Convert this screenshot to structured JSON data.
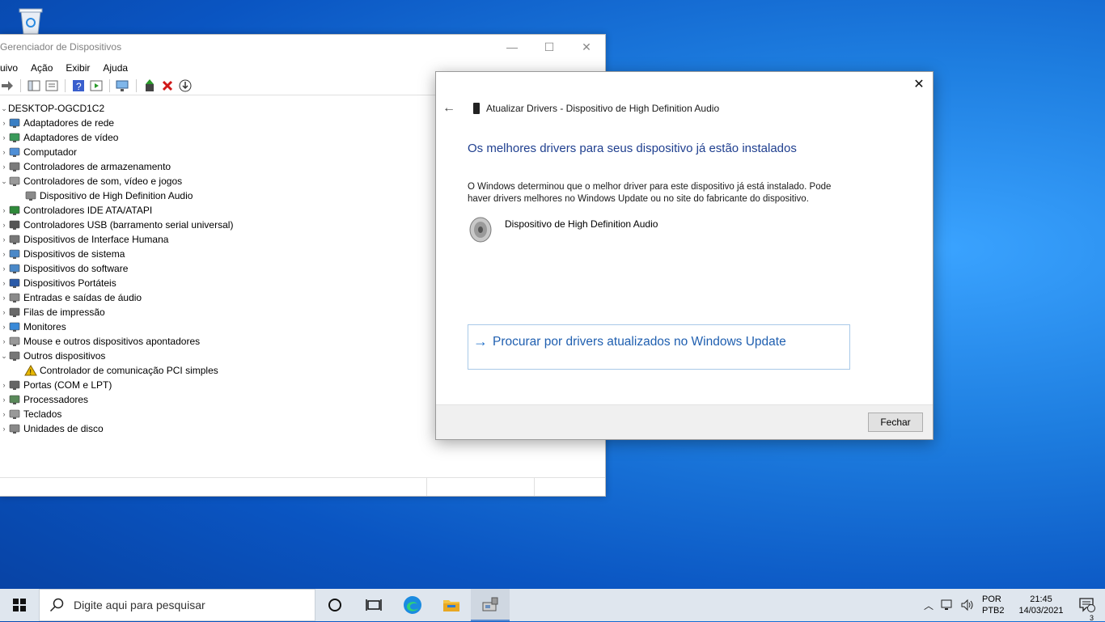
{
  "device_manager": {
    "title": "Gerenciador de Dispositivos",
    "menu": [
      "uivo",
      "Ação",
      "Exibir",
      "Ajuda"
    ],
    "root": "DESKTOP-OGCD1C2",
    "tree": [
      {
        "label": "Adaptadores de rede",
        "level": 1,
        "expander": "›",
        "icon": "network-adapter-icon"
      },
      {
        "label": "Adaptadores de vídeo",
        "level": 1,
        "expander": "›",
        "icon": "display-adapter-icon"
      },
      {
        "label": "Computador",
        "level": 1,
        "expander": "›",
        "icon": "computer-icon"
      },
      {
        "label": "Controladores de armazenamento",
        "level": 1,
        "expander": "›",
        "icon": "storage-controller-icon"
      },
      {
        "label": "Controladores de som, vídeo e jogos",
        "level": 1,
        "expander": "⌄",
        "icon": "sound-icon"
      },
      {
        "label": "Dispositivo de High Definition Audio",
        "level": 2,
        "expander": "",
        "icon": "speaker-icon"
      },
      {
        "label": "Controladores IDE ATA/ATAPI",
        "level": 1,
        "expander": "›",
        "icon": "ide-controller-icon"
      },
      {
        "label": "Controladores USB (barramento serial universal)",
        "level": 1,
        "expander": "›",
        "icon": "usb-icon"
      },
      {
        "label": "Dispositivos de Interface Humana",
        "level": 1,
        "expander": "›",
        "icon": "hid-icon"
      },
      {
        "label": "Dispositivos de sistema",
        "level": 1,
        "expander": "›",
        "icon": "system-device-icon"
      },
      {
        "label": "Dispositivos do software",
        "level": 1,
        "expander": "›",
        "icon": "software-device-icon"
      },
      {
        "label": "Dispositivos Portáteis",
        "level": 1,
        "expander": "›",
        "icon": "portable-device-icon"
      },
      {
        "label": "Entradas e saídas de áudio",
        "level": 1,
        "expander": "›",
        "icon": "audio-io-icon"
      },
      {
        "label": "Filas de impressão",
        "level": 1,
        "expander": "›",
        "icon": "printer-icon"
      },
      {
        "label": "Monitores",
        "level": 1,
        "expander": "›",
        "icon": "monitor-icon"
      },
      {
        "label": "Mouse e outros dispositivos apontadores",
        "level": 1,
        "expander": "›",
        "icon": "mouse-icon"
      },
      {
        "label": "Outros dispositivos",
        "level": 1,
        "expander": "⌄",
        "icon": "other-device-icon"
      },
      {
        "label": "Controlador de comunicação PCI simples",
        "level": 2,
        "expander": "",
        "icon": "warning-icon"
      },
      {
        "label": "Portas (COM e LPT)",
        "level": 1,
        "expander": "›",
        "icon": "port-icon"
      },
      {
        "label": "Processadores",
        "level": 1,
        "expander": "›",
        "icon": "processor-icon"
      },
      {
        "label": "Teclados",
        "level": 1,
        "expander": "›",
        "icon": "keyboard-icon"
      },
      {
        "label": "Unidades de disco",
        "level": 1,
        "expander": "›",
        "icon": "disk-drive-icon"
      }
    ]
  },
  "dialog": {
    "header_title": "Atualizar Drivers - Dispositivo de High Definition Audio",
    "heading": "Os melhores drivers para seus dispositivo já estão instalados",
    "paragraph": "O Windows determinou que o melhor driver para este dispositivo já está instalado. Pode haver drivers melhores no Windows Update ou no site do fabricante do dispositivo.",
    "device_name": "Dispositivo de High Definition Audio",
    "link": "Procurar por drivers atualizados no Windows Update",
    "close_button": "Fechar"
  },
  "taskbar": {
    "search_placeholder": "Digite aqui para pesquisar",
    "lang_line1": "POR",
    "lang_line2": "PTB2",
    "time": "21:45",
    "date": "14/03/2021",
    "notification_count": "3"
  },
  "colors": {
    "heading": "#1f3f8f",
    "link": "#1f5fb0",
    "desktop": "#1e7ee0"
  }
}
